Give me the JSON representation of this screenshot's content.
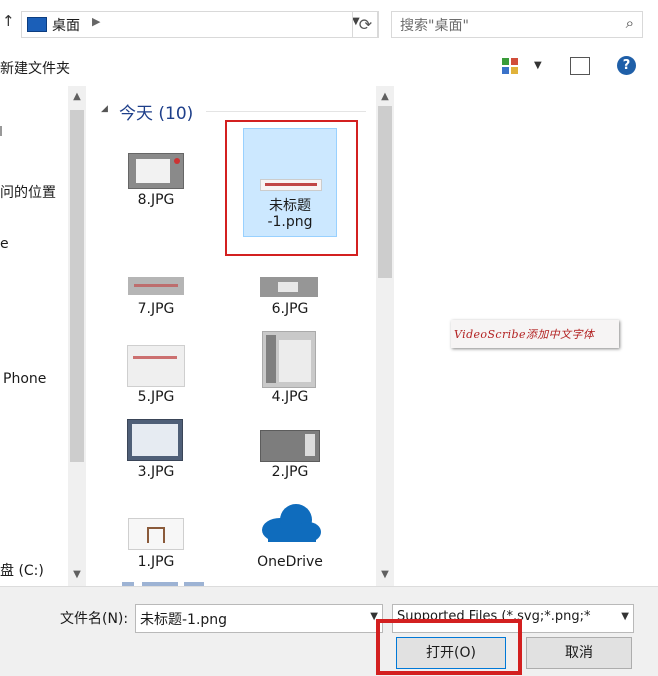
{
  "address_bar": {
    "location": "桌面",
    "search_placeholder": "搜索\"桌面\""
  },
  "toolbar": {
    "new_folder": "新建文件夹"
  },
  "nav_pane": {
    "items": [
      "问的位置",
      "e",
      "Phone",
      "盘 (C:)"
    ]
  },
  "file_pane": {
    "group_header": "今天 (10)",
    "items": [
      {
        "name": "8.JPG"
      },
      {
        "name": "未标题-1.png",
        "line1": "未标题",
        "line2": "-1.png",
        "selected": true
      },
      {
        "name": "7.JPG"
      },
      {
        "name": "6.JPG"
      },
      {
        "name": "5.JPG"
      },
      {
        "name": "4.JPG"
      },
      {
        "name": "3.JPG"
      },
      {
        "name": "2.JPG"
      },
      {
        "name": "1.JPG"
      },
      {
        "name": "OneDrive"
      }
    ]
  },
  "preview": {
    "image_text": "VideoScribe添加中文字体"
  },
  "bottom": {
    "filename_label": "文件名(N):",
    "filename_value": "未标题-1.png",
    "filetype_value": "Supported Files (*.svg;*.png;*",
    "open_button": "打开(O)",
    "cancel_button": "取消"
  },
  "colors": {
    "selection_fill": "#cce8ff",
    "highlight_red": "#d32020",
    "onedrive_blue": "#0f6cbd"
  }
}
